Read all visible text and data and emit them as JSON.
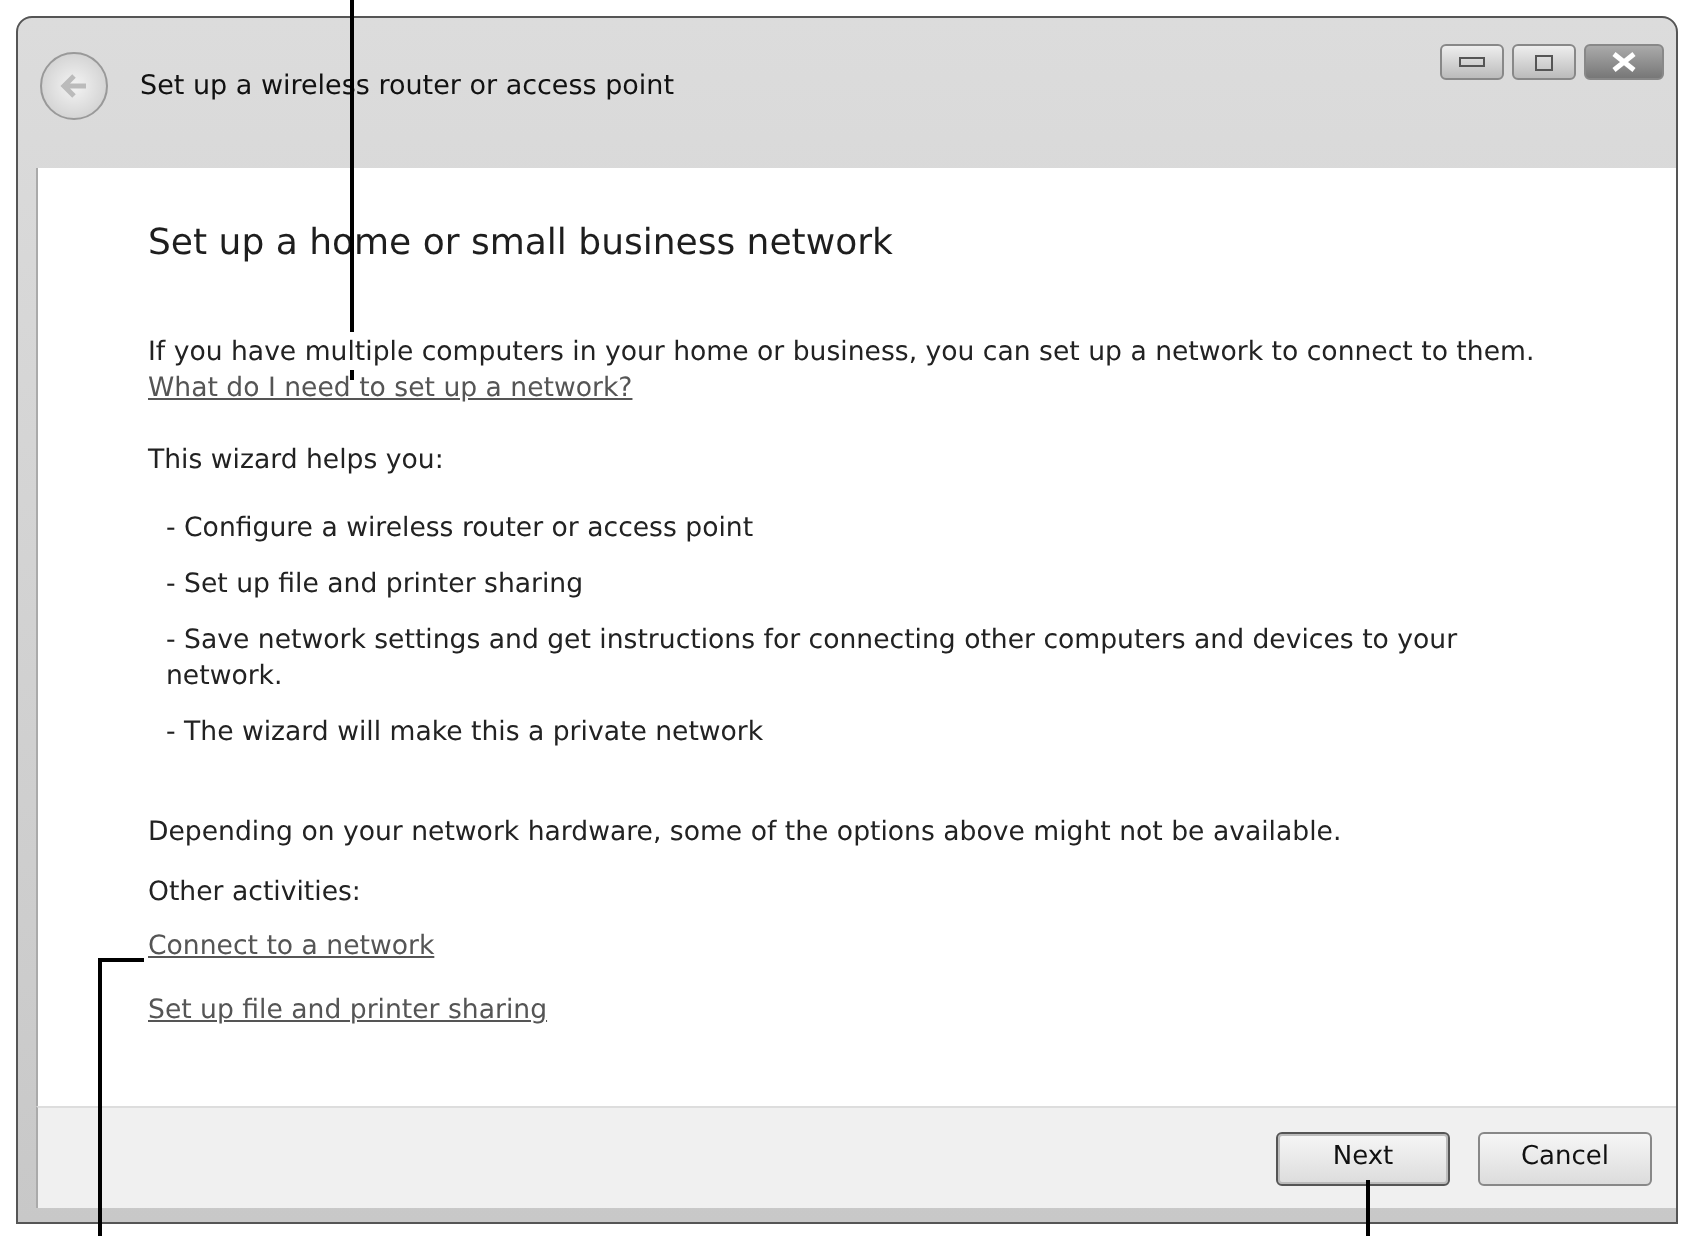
{
  "window": {
    "title": "Set up a wireless router or access point"
  },
  "heading": "Set up a home or small business network",
  "intro": {
    "text": "If you have multiple computers in your home or business, you can set up a network to connect to them.",
    "link": "What do I need to set up a network?"
  },
  "helps_label": "This wizard helps you:",
  "bullets": [
    "- Configure a wireless router or access point",
    "- Set up file and printer sharing",
    "- Save network settings and get instructions for connecting other computers and devices to your network.",
    "- The wizard will make this a private network"
  ],
  "note": "Depending on your network hardware, some of the options above might not be available.",
  "other_label": "Other activities:",
  "links": [
    "Connect to a network",
    "Set up file and printer sharing"
  ],
  "buttons": [
    {
      "label": "Next",
      "kind": "default"
    },
    {
      "label": "Cancel",
      "kind": "normal"
    }
  ]
}
